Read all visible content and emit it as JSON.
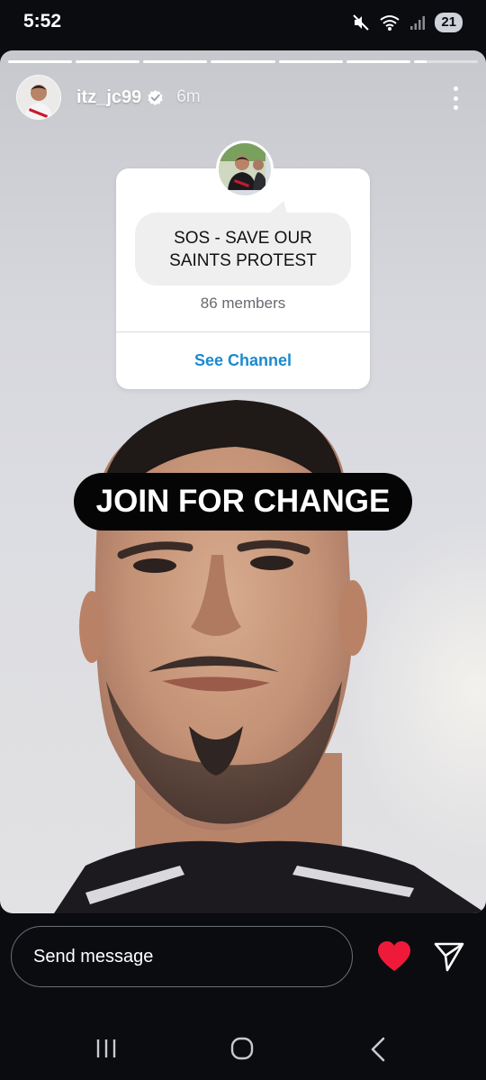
{
  "status_bar": {
    "time": "5:52",
    "battery": "21",
    "icons": [
      "mute-icon",
      "wifi-icon",
      "signal-icon"
    ]
  },
  "story": {
    "progress": {
      "segments_total": 7,
      "segments_completed": 6,
      "current_fraction": 0.2
    },
    "header": {
      "username": "itz_jc99",
      "verified": true,
      "time_ago": "6m",
      "menu_icon": "more-vertical-icon"
    },
    "channel_card": {
      "name": "SOS - SAVE OUR SAINTS PROTEST",
      "members": "86 members",
      "action_label": "See Channel"
    },
    "sticker_text": "JOIN FOR CHANGE"
  },
  "reply_bar": {
    "placeholder": "Send message",
    "like_icon": "heart-icon",
    "like_color": "#ef1a3a",
    "share_icon": "send-icon"
  },
  "nav_bar": {
    "buttons": [
      "recents-icon",
      "home-icon",
      "back-icon"
    ]
  }
}
